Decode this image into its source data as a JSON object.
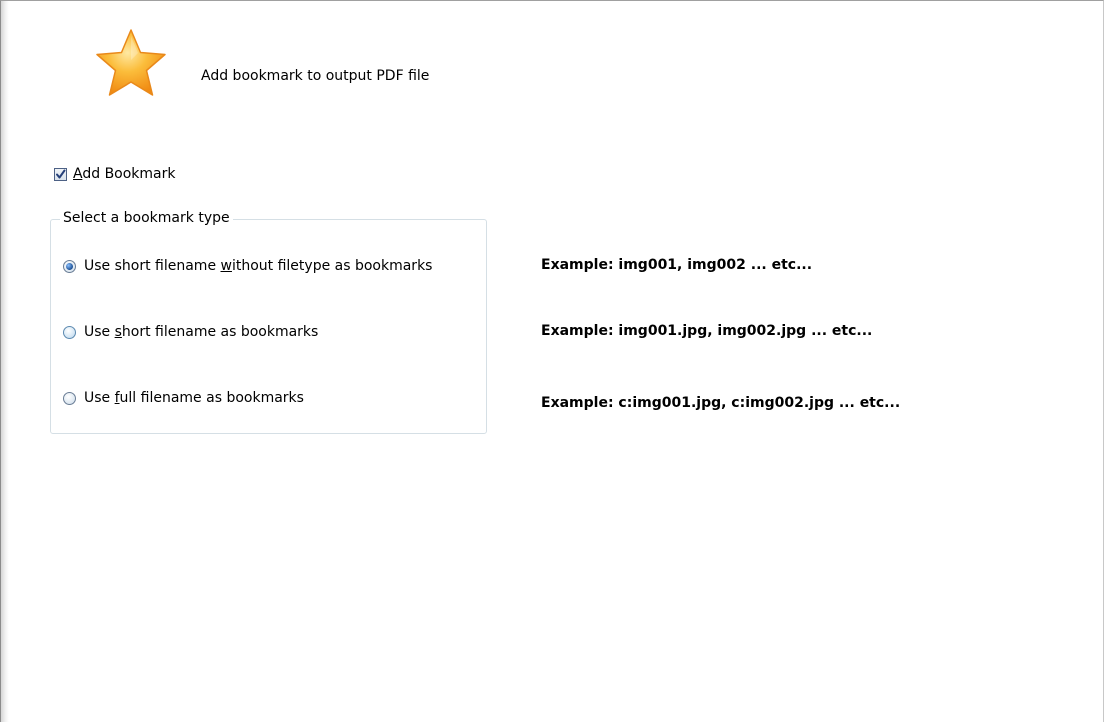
{
  "header": {
    "icon": "star-icon",
    "title": "Add bookmark to output PDF file"
  },
  "add_bookmark": {
    "checked": true,
    "mnemonic": "A",
    "rest": "dd Bookmark"
  },
  "bookmark_type": {
    "legend": "Select a bookmark type",
    "options": [
      {
        "selected": true,
        "before": "Use short filename ",
        "mnemonic": "w",
        "after": "ithout filetype as bookmarks",
        "example": "Example:  img001, img002 ... etc..."
      },
      {
        "selected": false,
        "before": "Use ",
        "mnemonic": "s",
        "after": "hort filename as bookmarks",
        "example": "Example:  img001.jpg, img002.jpg ... etc..."
      },
      {
        "selected": false,
        "before": "Use ",
        "mnemonic": "f",
        "after": "ull filename as bookmarks",
        "example": "Example:  c:img001.jpg, c:img002.jpg ... etc..."
      }
    ]
  },
  "colors": {
    "star_fill": "#f8a51b",
    "star_highlight": "#ffd97a",
    "radio_selected_dot": "#1b4f94"
  }
}
